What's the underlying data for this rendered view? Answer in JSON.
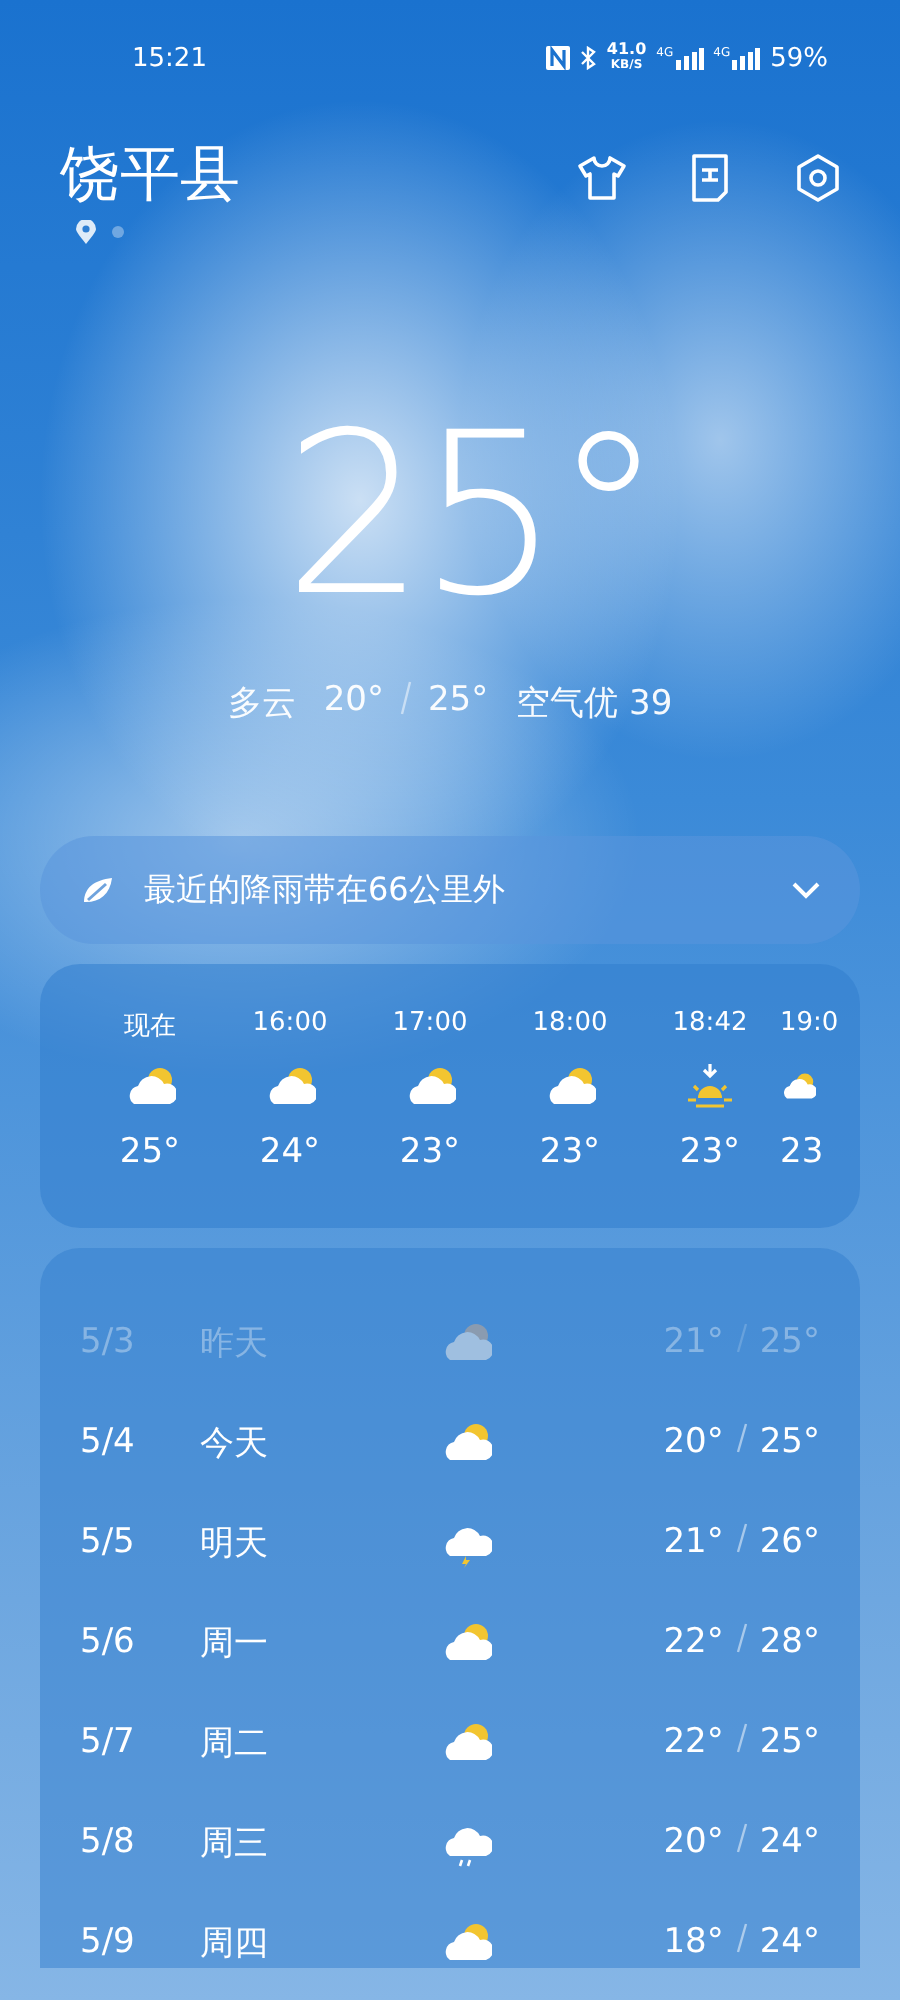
{
  "status_bar": {
    "time": "15:21",
    "net_speed": "41.0",
    "net_unit": "KB/S",
    "sim1": "4G",
    "sim2": "4G",
    "battery": "59%"
  },
  "header": {
    "city": "饶平县",
    "pages": [
      {
        "kind": "location",
        "selected": true
      },
      {
        "kind": "city",
        "selected": false
      }
    ]
  },
  "current": {
    "temperature": "25°",
    "condition": "多云",
    "low": "20°",
    "high": "25°",
    "air_quality": "空气优 39"
  },
  "rain_alert": {
    "text": "最近的降雨带在66公里外",
    "expanded": false
  },
  "hourly": [
    {
      "time": "现在",
      "kind": "cloudy",
      "temp": "25°"
    },
    {
      "time": "16:00",
      "kind": "cloudy",
      "temp": "24°"
    },
    {
      "time": "17:00",
      "kind": "cloudy",
      "temp": "23°"
    },
    {
      "time": "18:00",
      "kind": "cloudy",
      "temp": "23°"
    },
    {
      "time": "18:42",
      "kind": "sunset",
      "temp": "23°"
    },
    {
      "time": "19:0",
      "kind": "cloudy",
      "temp": "23"
    }
  ],
  "daily": [
    {
      "date": "5/3",
      "day": "昨天",
      "kind": "cloudy",
      "low": "21°",
      "high": "25°",
      "past": true
    },
    {
      "date": "5/4",
      "day": "今天",
      "kind": "cloudy",
      "low": "20°",
      "high": "25°",
      "past": false
    },
    {
      "date": "5/5",
      "day": "明天",
      "kind": "thunder",
      "low": "21°",
      "high": "26°",
      "past": false
    },
    {
      "date": "5/6",
      "day": "周一",
      "kind": "cloudy",
      "low": "22°",
      "high": "28°",
      "past": false
    },
    {
      "date": "5/7",
      "day": "周二",
      "kind": "cloudy",
      "low": "22°",
      "high": "25°",
      "past": false
    },
    {
      "date": "5/8",
      "day": "周三",
      "kind": "rain",
      "low": "20°",
      "high": "24°",
      "past": false
    },
    {
      "date": "5/9",
      "day": "周四",
      "kind": "cloudy",
      "low": "18°",
      "high": "24°",
      "past": false
    }
  ]
}
